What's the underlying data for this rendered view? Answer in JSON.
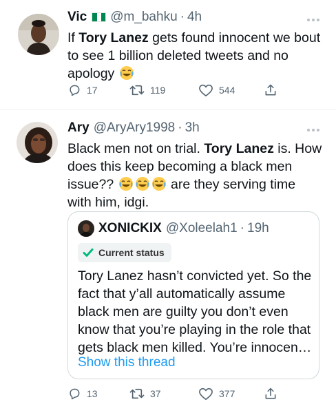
{
  "tweets": [
    {
      "name": "Vic",
      "handle": "@m_bahku",
      "time": "4h",
      "text_parts": [
        "If ",
        "Tory Lanez",
        " gets found innocent we bout to see 1 billion deleted tweets and no apology "
      ],
      "replies": "17",
      "retweets": "119",
      "likes": "544",
      "flag_colors": [
        "#008751",
        "#ffffff",
        "#008751"
      ]
    },
    {
      "name": "Ary",
      "handle": "@AryAry1998",
      "time": "3h",
      "text_parts": [
        "Black men not on trial. ",
        "Tory Lanez",
        " is. How does this keep becoming a black men issue?? ",
        " are they serving time with him, idgi."
      ],
      "replies": "13",
      "retweets": "37",
      "likes": "377"
    }
  ],
  "quote": {
    "name": "XONICKIX",
    "handle": "@Xoleelah1",
    "time": "19h",
    "badge": "Current status",
    "text": "Tory Lanez hasn’t convicted yet. So the fact that y’all automatically assume black men are guilty you don’t even know that you’re playing in the role that gets black men killed. You’re innocen…",
    "show_thread": "Show this thread"
  },
  "separator": "·",
  "icons": {
    "reply": "reply-icon",
    "retweet": "retweet-icon",
    "like": "heart-icon",
    "share": "share-icon",
    "more": "more-icon",
    "check": "check-icon",
    "emoji": "laughing-emoji-icon"
  },
  "colors": {
    "link": "#1d9bf0",
    "muted": "#536471",
    "check": "#00ba7c",
    "emoji": "#ffcc4d"
  }
}
